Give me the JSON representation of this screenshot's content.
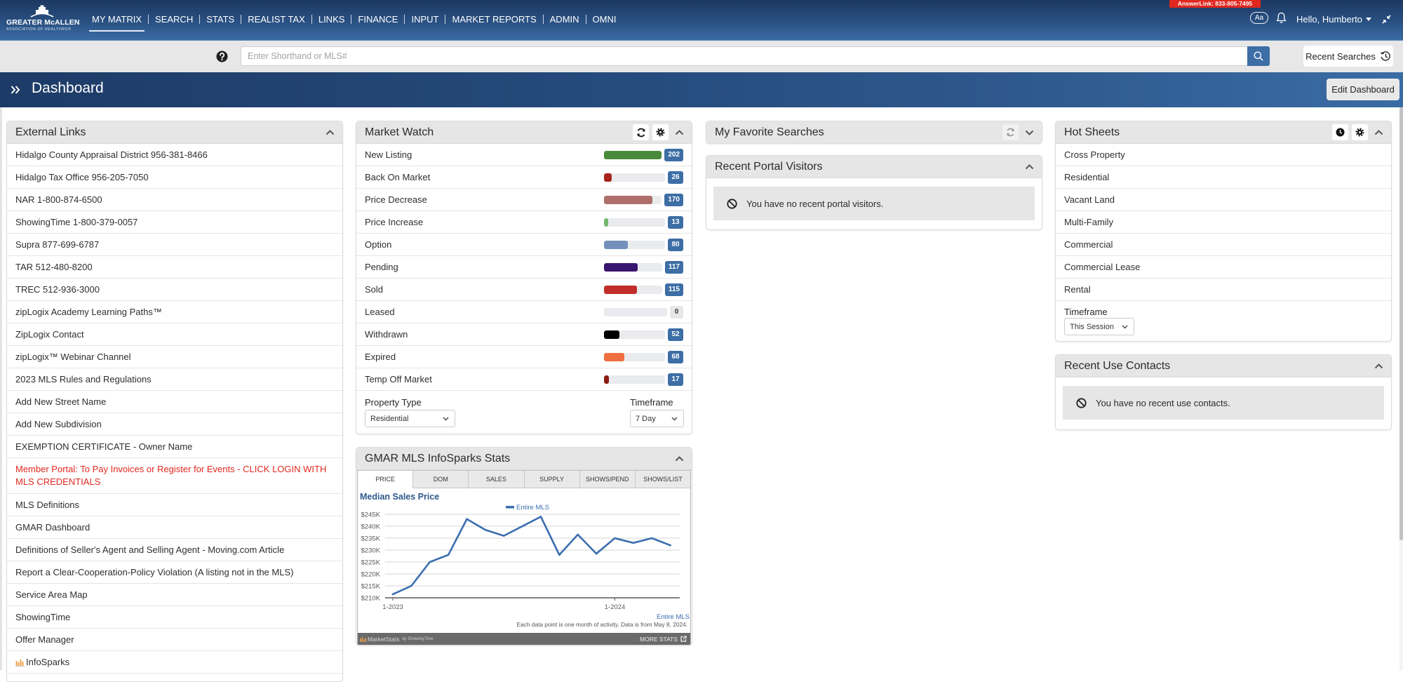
{
  "app": {
    "logo": {
      "line1": "GREATER McALLEN",
      "line2": "ASSOCIATION OF REALTORS®"
    }
  },
  "topnav": {
    "items": [
      {
        "label": "MY MATRIX",
        "active": true
      },
      {
        "label": "SEARCH",
        "active": false
      },
      {
        "label": "STATS",
        "active": false
      },
      {
        "label": "REALIST TAX",
        "active": false
      },
      {
        "label": "LINKS",
        "active": false
      },
      {
        "label": "FINANCE",
        "active": false
      },
      {
        "label": "INPUT",
        "active": false
      },
      {
        "label": "MARKET REPORTS",
        "active": false
      },
      {
        "label": "ADMIN",
        "active": false
      },
      {
        "label": "OMNI",
        "active": false
      }
    ],
    "answerlink": "AnswerLink: 833-805-7495",
    "font_size_button": "Aa",
    "greeting": "Hello, Humberto",
    "icons": [
      "bell-icon",
      "caret-down-icon",
      "compress-icon"
    ]
  },
  "search": {
    "placeholder": "Enter Shorthand or MLS#",
    "value": "",
    "recent_searches_label": "Recent Searches",
    "icons": [
      "help-icon",
      "search-icon",
      "history-icon"
    ]
  },
  "page": {
    "title": "Dashboard",
    "edit_button": "Edit Dashboard"
  },
  "external_links": {
    "title": "External Links",
    "items": [
      {
        "label": "Hidalgo County Appraisal District 956-381-8466",
        "highlight": false
      },
      {
        "label": "Hidalgo Tax Office 956-205-7050",
        "highlight": false
      },
      {
        "label": "NAR 1-800-874-6500",
        "highlight": false
      },
      {
        "label": "ShowingTime 1-800-379-0057",
        "highlight": false
      },
      {
        "label": "Supra 877-699-6787",
        "highlight": false
      },
      {
        "label": "TAR 512-480-8200",
        "highlight": false
      },
      {
        "label": "TREC 512-936-3000",
        "highlight": false
      },
      {
        "label": "zipLogix Academy Learning Paths™",
        "highlight": false
      },
      {
        "label": "ZipLogix Contact",
        "highlight": false
      },
      {
        "label": "zipLogix™ Webinar Channel",
        "highlight": false
      },
      {
        "label": "2023 MLS Rules and Regulations",
        "highlight": false
      },
      {
        "label": "Add New Street Name",
        "highlight": false
      },
      {
        "label": "Add New Subdivision",
        "highlight": false
      },
      {
        "label": "EXEMPTION CERTIFICATE - Owner Name",
        "highlight": false
      },
      {
        "label": "Member Portal: To Pay Invoices or Register for Events - CLICK LOGIN WITH MLS CREDENTIALS",
        "highlight": true
      },
      {
        "label": "MLS Definitions",
        "highlight": false
      },
      {
        "label": "GMAR Dashboard",
        "highlight": false
      },
      {
        "label": "Definitions of Seller's Agent and Selling Agent - Moving.com Article",
        "highlight": false
      },
      {
        "label": "Report a Clear-Cooperation-Policy Violation (A listing not in the MLS)",
        "highlight": false
      },
      {
        "label": "Service Area Map",
        "highlight": false
      },
      {
        "label": "ShowingTime",
        "highlight": false
      },
      {
        "label": "Offer Manager",
        "highlight": false
      },
      {
        "label": "InfoSparks",
        "highlight": false,
        "icon": "bar-chart-icon"
      }
    ]
  },
  "market_watch": {
    "title": "Market Watch",
    "items": [
      {
        "label": "New Listing",
        "count": 202,
        "color": "#4a8b3b"
      },
      {
        "label": "Back On Market",
        "count": 26,
        "color": "#a8231c"
      },
      {
        "label": "Price Decrease",
        "count": 170,
        "color": "#b06e6a"
      },
      {
        "label": "Price Increase",
        "count": 13,
        "color": "#74b86e"
      },
      {
        "label": "Option",
        "count": 80,
        "color": "#7391bb"
      },
      {
        "label": "Pending",
        "count": 117,
        "color": "#3a1670"
      },
      {
        "label": "Sold",
        "count": 115,
        "color": "#c12e2a"
      },
      {
        "label": "Leased",
        "count": 0,
        "color": "#e9ebee"
      },
      {
        "label": "Withdrawn",
        "count": 52,
        "color": "#000000"
      },
      {
        "label": "Expired",
        "count": 68,
        "color": "#ee6e3f"
      },
      {
        "label": "Temp Off Market",
        "count": 17,
        "color": "#8c1b12"
      }
    ],
    "property_type": {
      "label": "Property Type",
      "value": "Residential"
    },
    "timeframe": {
      "label": "Timeframe",
      "value": "7 Day"
    }
  },
  "infosparks": {
    "title": "GMAR MLS InfoSparks Stats",
    "tabs": [
      {
        "label": "PRICE",
        "active": true
      },
      {
        "label": "DOM",
        "active": false
      },
      {
        "label": "SALES",
        "active": false
      },
      {
        "label": "SUPPLY",
        "active": false
      },
      {
        "label": "SHOWS/PEND",
        "active": false
      },
      {
        "label": "SHOWS/LIST",
        "active": false
      }
    ],
    "footer": {
      "brand": "MarketStats",
      "brand_by": "by ShowingTime",
      "more_stats": "MORE STATS"
    }
  },
  "favorite_searches": {
    "title": "My Favorite Searches"
  },
  "portal_visitors": {
    "title": "Recent Portal Visitors",
    "empty_message": "You have no recent portal visitors."
  },
  "hot_sheets": {
    "title": "Hot Sheets",
    "items": [
      {
        "label": "Cross Property"
      },
      {
        "label": "Residential"
      },
      {
        "label": "Vacant Land"
      },
      {
        "label": "Multi-Family"
      },
      {
        "label": "Commercial"
      },
      {
        "label": "Commercial Lease"
      },
      {
        "label": "Rental"
      }
    ],
    "timeframe": {
      "label": "Timeframe",
      "value": "This Session"
    }
  },
  "recent_contacts": {
    "title": "Recent Use Contacts",
    "empty_message": "You have no recent use contacts."
  },
  "colors": {
    "accent": "#3d6ea5",
    "badge": "#3d6ea5",
    "alert_link": "#e0281f",
    "answerlink_bg": "#e0281f",
    "chart_line": "#3a6eb0",
    "chart_title": "#2e5a8c"
  },
  "chart_data": {
    "type": "line",
    "title": "Median Sales Price",
    "xlabel": "",
    "ylabel": "",
    "categories": [
      "1-2023",
      "2-2023",
      "3-2023",
      "4-2023",
      "5-2023",
      "6-2023",
      "7-2023",
      "8-2023",
      "9-2023",
      "10-2023",
      "11-2023",
      "12-2023",
      "1-2024",
      "2-2024",
      "3-2024",
      "4-2024"
    ],
    "series": [
      {
        "name": "Entire MLS",
        "color": "#3a6eb0",
        "values": [
          211500,
          215000,
          225000,
          228000,
          243000,
          238500,
          236000,
          240000,
          244000,
          228000,
          236500,
          228500,
          235000,
          233000,
          235000,
          232000
        ]
      }
    ],
    "ylim": [
      210000,
      245000
    ],
    "yticks": [
      210000,
      215000,
      220000,
      225000,
      230000,
      235000,
      240000,
      245000
    ],
    "ytick_labels": [
      "$210K",
      "$215K",
      "$220K",
      "$225K",
      "$230K",
      "$235K",
      "$240K",
      "$245K"
    ],
    "xticks": [
      {
        "index": 0,
        "label": "1-2023"
      },
      {
        "index": 12,
        "label": "1-2024"
      }
    ],
    "grid": true,
    "legend": "top-center",
    "legend_entries": [
      "Entire MLS"
    ],
    "source_link": "Entire MLS",
    "note": "Each data point is one month of activity. Data is from May 8, 2024."
  }
}
